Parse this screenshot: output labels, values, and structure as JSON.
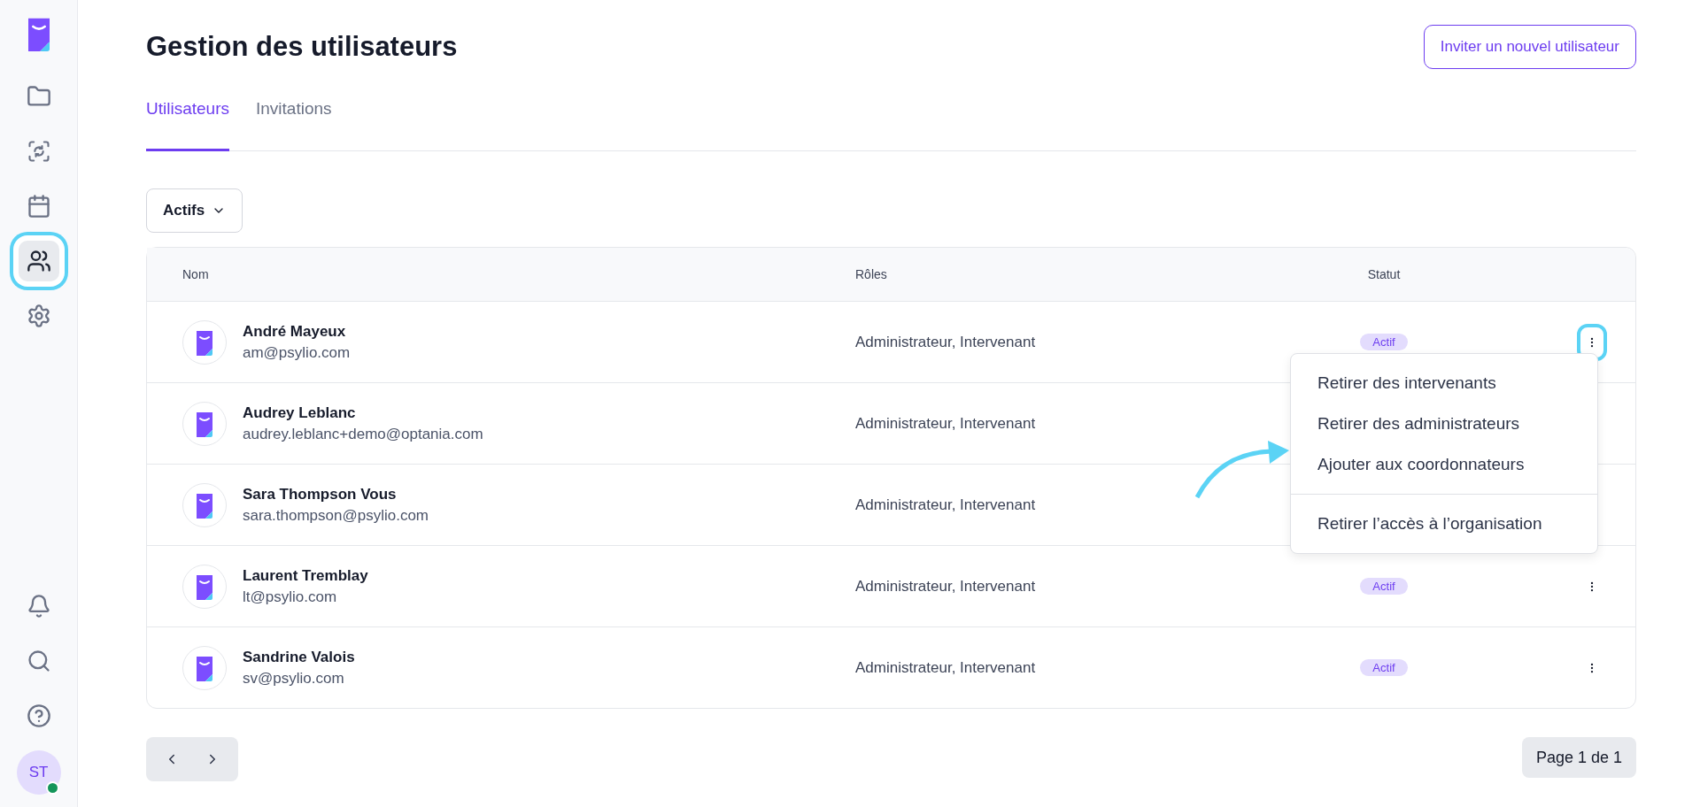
{
  "sidebar": {
    "items": [
      {
        "kind": "folder",
        "selected": false,
        "highlighted": false
      },
      {
        "kind": "scan",
        "selected": false,
        "highlighted": false
      },
      {
        "kind": "calendar",
        "selected": false,
        "highlighted": false
      },
      {
        "kind": "users",
        "selected": true,
        "highlighted": true
      },
      {
        "kind": "settings",
        "selected": false,
        "highlighted": false
      }
    ],
    "bottom_items": [
      {
        "kind": "bell"
      },
      {
        "kind": "search"
      },
      {
        "kind": "help"
      }
    ],
    "avatar": {
      "initials": "ST",
      "online": true
    }
  },
  "page": {
    "title": "Gestion des utilisateurs",
    "invite_button": "Inviter un nouvel utilisateur"
  },
  "tabs": [
    {
      "label": "Utilisateurs",
      "selected": true
    },
    {
      "label": "Invitations",
      "selected": false
    }
  ],
  "filter": {
    "label": "Actifs"
  },
  "table": {
    "columns": [
      "Nom",
      "Rôles",
      "Statut"
    ],
    "rows": [
      {
        "name": "André Mayeux",
        "email": "am@psylio.com",
        "roles": "Administrateur, Intervenant",
        "status": "Actif",
        "menu_highlighted": true
      },
      {
        "name": "Audrey Leblanc",
        "email": "audrey.leblanc+demo@optania.com",
        "roles": "Administrateur, Intervenant"
      },
      {
        "name": "Sara Thompson Vous",
        "email": "sara.thompson@psylio.com",
        "roles": "Administrateur, Intervenant"
      },
      {
        "name": "Laurent Tremblay",
        "email": "lt@psylio.com",
        "roles": "Administrateur, Intervenant",
        "status": "Actif",
        "menu_highlighted": false
      },
      {
        "name": "Sandrine Valois",
        "email": "sv@psylio.com",
        "roles": "Administrateur, Intervenant",
        "status": "Actif",
        "menu_highlighted": false
      }
    ]
  },
  "context_menu": {
    "groups": [
      [
        {
          "label": "Retirer des intervenants"
        },
        {
          "label": "Retirer des administrateurs"
        },
        {
          "label": "Ajouter aux coordonnateurs",
          "pointed": true
        }
      ],
      [
        {
          "label": "Retirer l’accès à l’organisation"
        }
      ]
    ]
  },
  "pagination": {
    "label": "Page 1 de 1"
  }
}
